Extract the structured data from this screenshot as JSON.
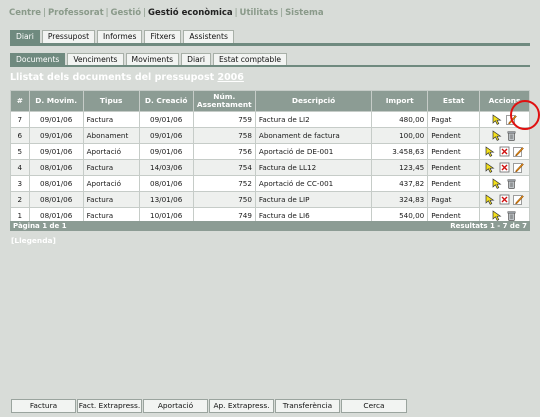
{
  "topnav": {
    "items": [
      "Centre",
      "Professorat",
      "Gestió",
      "Gestió econòmica",
      "Utilitats",
      "Sistema"
    ],
    "separator": "|"
  },
  "tabs_main": [
    "Diari",
    "Pressupost",
    "Informes",
    "Fitxers",
    "Assistents"
  ],
  "tabs_sub": [
    "Documents",
    "Venciments",
    "Moviments",
    "Diari",
    "Estat comptable"
  ],
  "title": {
    "prefix": "Llistat dels documents del pressupost ",
    "year": "2006"
  },
  "table": {
    "headers": [
      "#",
      "D. Movim.",
      "Tipus",
      "D. Creació",
      "Núm. Assentament",
      "Descripció",
      "Import",
      "Estat",
      "Accions"
    ],
    "rows": [
      {
        "n": "7",
        "dmov": "09/01/06",
        "tipus": "Factura",
        "dcre": "09/01/06",
        "num": "759",
        "desc": "Factura de LI2",
        "imp": "480,00",
        "estat": "Pagat",
        "actions": [
          "select",
          "edit"
        ]
      },
      {
        "n": "6",
        "dmov": "09/01/06",
        "tipus": "Abonament",
        "dcre": "09/01/06",
        "num": "758",
        "desc": "Abonament de factura",
        "imp": "100,00",
        "estat": "Pendent",
        "actions": [
          "select",
          "delete"
        ]
      },
      {
        "n": "5",
        "dmov": "09/01/06",
        "tipus": "Aportació",
        "dcre": "09/01/06",
        "num": "756",
        "desc": "Aportació de DE-001",
        "imp": "3.458,63",
        "estat": "Pendent",
        "actions": [
          "select",
          "cancel",
          "edit"
        ]
      },
      {
        "n": "4",
        "dmov": "08/01/06",
        "tipus": "Factura",
        "dcre": "14/03/06",
        "num": "754",
        "desc": "Factura de LL12",
        "imp": "123,45",
        "estat": "Pendent",
        "actions": [
          "select",
          "cancel",
          "edit"
        ]
      },
      {
        "n": "3",
        "dmov": "08/01/06",
        "tipus": "Aportació",
        "dcre": "08/01/06",
        "num": "752",
        "desc": "Aportació de CC-001",
        "imp": "437,82",
        "estat": "Pendent",
        "actions": [
          "select",
          "delete"
        ]
      },
      {
        "n": "2",
        "dmov": "08/01/06",
        "tipus": "Factura",
        "dcre": "13/01/06",
        "num": "750",
        "desc": "Factura de LIP",
        "imp": "324,83",
        "estat": "Pagat",
        "actions": [
          "select",
          "cancel",
          "edit"
        ]
      },
      {
        "n": "1",
        "dmov": "08/01/06",
        "tipus": "Factura",
        "dcre": "10/01/06",
        "num": "749",
        "desc": "Factura de LI6",
        "imp": "540,00",
        "estat": "Pendent",
        "actions": [
          "select",
          "delete"
        ]
      }
    ]
  },
  "footer": {
    "page": "Pàgina 1 de 1",
    "results": "Resultats 1 - 7 de 7"
  },
  "legend_link": "[Llegenda]",
  "bottom_buttons": [
    "Factura",
    "Fact. Extrapress.",
    "Aportació",
    "Ap. Extrapress.",
    "Transferència",
    "Cerca"
  ],
  "colors": {
    "accent": "#6f8a7f",
    "header": "#8c9c94",
    "background": "#d8dcd8",
    "highlight": "#e01010"
  }
}
